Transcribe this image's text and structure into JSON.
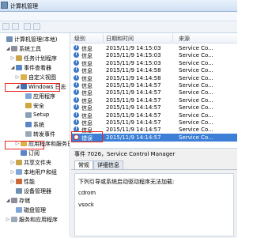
{
  "window": {
    "title": "计算机管理"
  },
  "tree": [
    {
      "label": "计算机管理(本地)",
      "indent": 0,
      "expander": ""
    },
    {
      "label": "系统工具",
      "indent": 1,
      "expander": "◢"
    },
    {
      "label": "任务计划程序",
      "indent": 2,
      "expander": "▷"
    },
    {
      "label": "事件查看器",
      "indent": 2,
      "expander": "◢"
    },
    {
      "label": "自定义视图",
      "indent": 3,
      "expander": "▷"
    },
    {
      "label": "Windows 日志",
      "indent": 3,
      "expander": "◢"
    },
    {
      "label": "应用程序",
      "indent": 4,
      "expander": ""
    },
    {
      "label": "安全",
      "indent": 4,
      "expander": ""
    },
    {
      "label": "Setup",
      "indent": 4,
      "expander": ""
    },
    {
      "label": "系统",
      "indent": 4,
      "expander": ""
    },
    {
      "label": "转发事件",
      "indent": 4,
      "expander": ""
    },
    {
      "label": "应用程序和服务日志",
      "indent": 3,
      "expander": "▷"
    },
    {
      "label": "订阅",
      "indent": 3,
      "expander": ""
    },
    {
      "label": "共享文件夹",
      "indent": 2,
      "expander": "▷"
    },
    {
      "label": "本地用户和组",
      "indent": 2,
      "expander": "▷"
    },
    {
      "label": "性能",
      "indent": 2,
      "expander": "▷"
    },
    {
      "label": "设备管理器",
      "indent": 2,
      "expander": ""
    },
    {
      "label": "存储",
      "indent": 1,
      "expander": "◢"
    },
    {
      "label": "磁盘管理",
      "indent": 2,
      "expander": ""
    },
    {
      "label": "服务和应用程序",
      "indent": 1,
      "expander": "▷"
    }
  ],
  "list": {
    "columns": [
      "级别",
      "日期和时间",
      "来源"
    ],
    "rows": [
      {
        "level": "信息",
        "datetime": "2015/11/9 14:15:03",
        "source": "Service Co...",
        "type": "info"
      },
      {
        "level": "信息",
        "datetime": "2015/11/9 14:15:03",
        "source": "Service Co...",
        "type": "info"
      },
      {
        "level": "信息",
        "datetime": "2015/11/9 14:15:03",
        "source": "Service Co...",
        "type": "info"
      },
      {
        "level": "信息",
        "datetime": "2015/11/9 14:14:58",
        "source": "Service Co...",
        "type": "info"
      },
      {
        "level": "信息",
        "datetime": "2015/11/9 14:14:58",
        "source": "Service Co...",
        "type": "info"
      },
      {
        "level": "信息",
        "datetime": "2015/11/9 14:14:57",
        "source": "Service Co...",
        "type": "info"
      },
      {
        "level": "信息",
        "datetime": "2015/11/9 14:14:57",
        "source": "Service Co...",
        "type": "info"
      },
      {
        "level": "信息",
        "datetime": "2015/11/9 14:14:57",
        "source": "Service Co...",
        "type": "info"
      },
      {
        "level": "信息",
        "datetime": "2015/11/9 14:14:57",
        "source": "Service Co...",
        "type": "info"
      },
      {
        "level": "信息",
        "datetime": "2015/11/9 14:14:57",
        "source": "Service Co...",
        "type": "info"
      },
      {
        "level": "信息",
        "datetime": "2015/11/9 14:14:57",
        "source": "Service Co...",
        "type": "info"
      },
      {
        "level": "信息",
        "datetime": "2015/11/9 14:14:57",
        "source": "Service Co...",
        "type": "info"
      },
      {
        "level": "错误",
        "datetime": "2015/11/9 14:14:57",
        "source": "Service Co...",
        "type": "error"
      }
    ]
  },
  "detail": {
    "title": "事件 7026，Service Control Manager",
    "tabs": [
      "常规",
      "详细信息"
    ],
    "lines": [
      "下列引导或系统启动驱动程序无法加载:",
      "cdrom",
      "vsock"
    ]
  },
  "colors": {
    "highlight": "#e8231e",
    "selection": "#3d7fd6"
  }
}
